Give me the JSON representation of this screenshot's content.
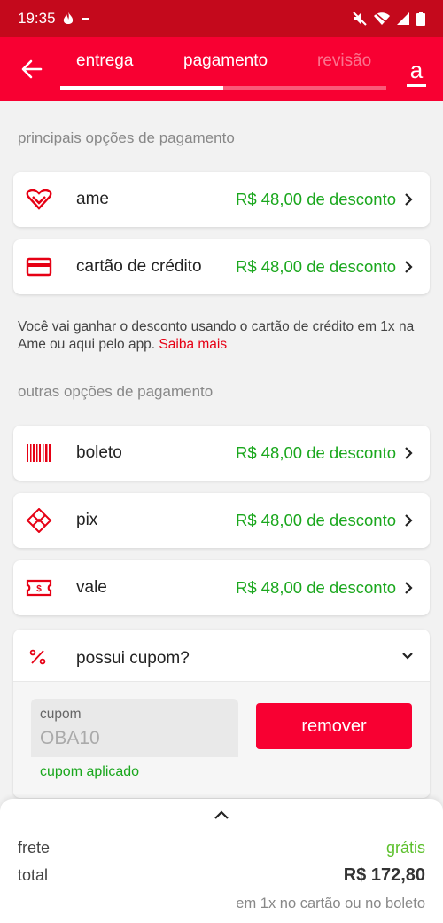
{
  "status_bar": {
    "time": "19:35",
    "icons": [
      "fire-icon",
      "dash-icon",
      "mute-icon",
      "wifi-icon",
      "signal-icon",
      "battery-icon"
    ]
  },
  "header": {
    "tabs": [
      {
        "label": "entrega"
      },
      {
        "label": "pagamento"
      },
      {
        "label": "revisão"
      }
    ],
    "progress": 0.5,
    "logo": "a",
    "colors": {
      "brand": "#f80032",
      "status_bar": "#c4091c"
    }
  },
  "main_options": {
    "title": "principais opções de pagamento",
    "items": [
      {
        "label": "ame",
        "discount": "R$ 48,00 de desconto",
        "icon": "heart-ame-icon"
      },
      {
        "label": "cartão de crédito",
        "discount": "R$ 48,00 de desconto",
        "icon": "credit-card-icon"
      }
    ]
  },
  "note": {
    "text": "Você vai ganhar o desconto usando o cartão de crédito em 1x na Ame ou aqui pelo app. ",
    "link": "Saiba mais"
  },
  "other_options": {
    "title": "outras opções de pagamento",
    "items": [
      {
        "label": "boleto",
        "discount": "R$ 48,00 de desconto",
        "icon": "barcode-icon"
      },
      {
        "label": "pix",
        "discount": "R$ 48,00 de desconto",
        "icon": "pix-icon"
      },
      {
        "label": "vale",
        "discount": "R$ 48,00 de desconto",
        "icon": "voucher-icon"
      }
    ]
  },
  "coupon": {
    "label": "possui cupom?",
    "field_label": "cupom",
    "value": "OBA10",
    "status": "cupom aplicado",
    "remove_label": "remover"
  },
  "summary": {
    "frete_label": "frete",
    "frete_value": "grátis",
    "total_label": "total",
    "total_value": "R$ 172,80",
    "hint": "em 1x no cartão ou no boleto"
  },
  "colors": {
    "discount_green": "#1aa71d",
    "accent_red": "#f80032"
  }
}
